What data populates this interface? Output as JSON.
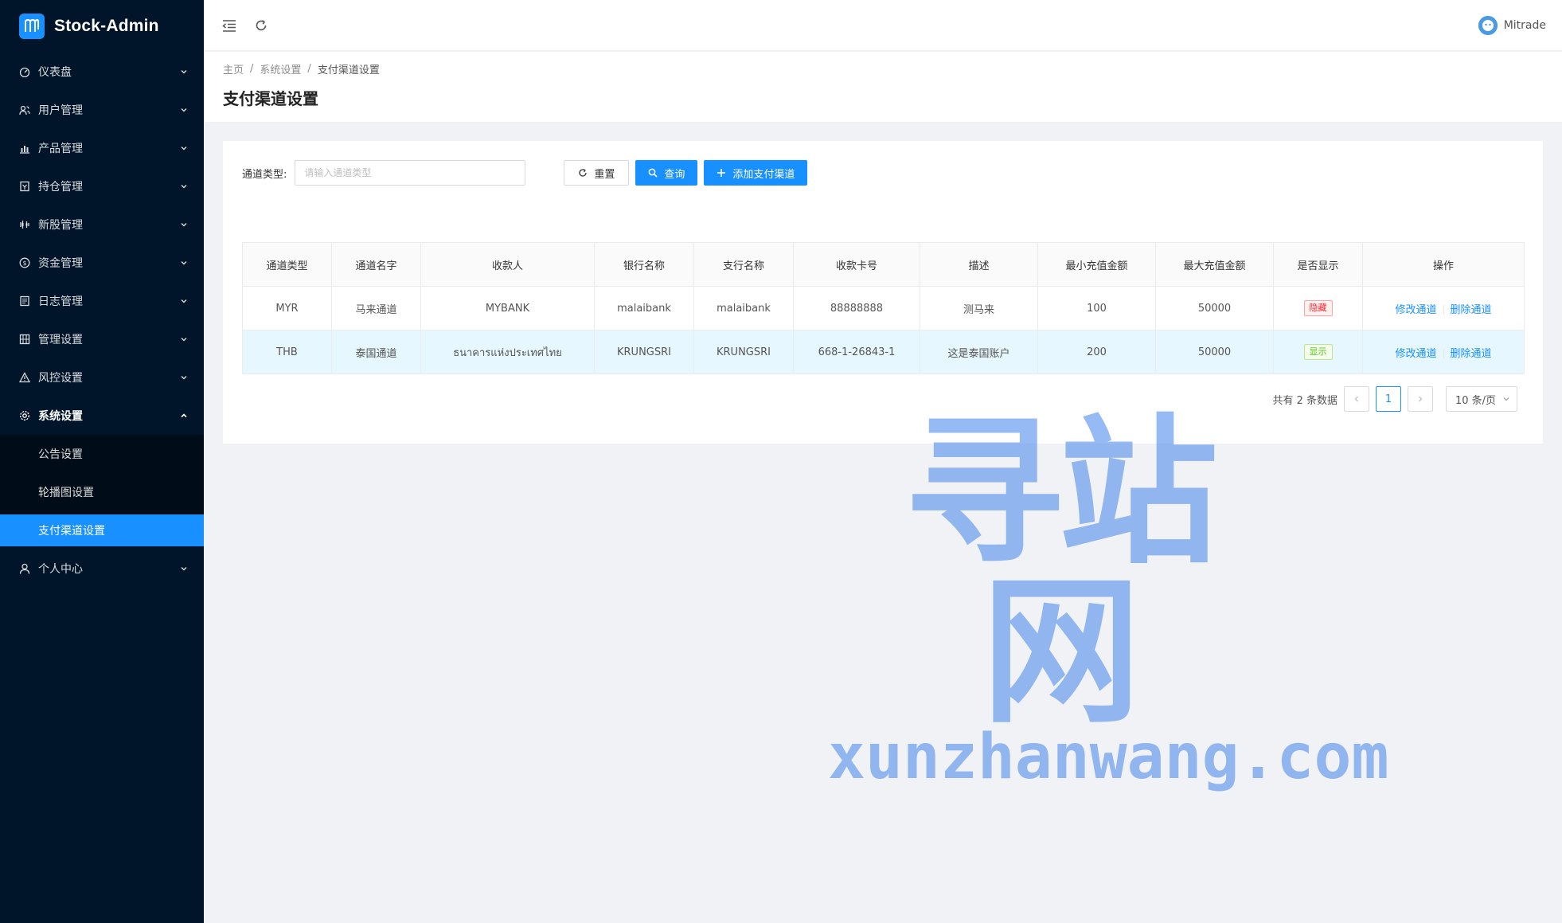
{
  "app": {
    "title": "Stock-Admin"
  },
  "sidebar": {
    "items": [
      {
        "label": "仪表盘",
        "icon": "dashboard-icon"
      },
      {
        "label": "用户管理",
        "icon": "users-icon"
      },
      {
        "label": "产品管理",
        "icon": "chart-icon"
      },
      {
        "label": "持仓管理",
        "icon": "position-icon"
      },
      {
        "label": "新股管理",
        "icon": "ipo-icon"
      },
      {
        "label": "资金管理",
        "icon": "money-icon"
      },
      {
        "label": "日志管理",
        "icon": "log-icon"
      },
      {
        "label": "管理设置",
        "icon": "admin-icon"
      },
      {
        "label": "风控设置",
        "icon": "warning-icon"
      },
      {
        "label": "系统设置",
        "icon": "gear-icon"
      }
    ],
    "submenu": [
      "公告设置",
      "轮播图设置",
      "支付渠道设置"
    ],
    "last_item": {
      "label": "个人中心",
      "icon": "user-icon"
    }
  },
  "header": {
    "username": "Mitrade"
  },
  "breadcrumb": [
    "主页",
    "系统设置",
    "支付渠道设置"
  ],
  "page_title": "支付渠道设置",
  "filter": {
    "label": "通道类型:",
    "placeholder": "请输入通道类型",
    "reset": "重置",
    "search": "查询",
    "add": "添加支付渠道"
  },
  "table": {
    "columns": [
      "通道类型",
      "通道名字",
      "收款人",
      "银行名称",
      "支行名称",
      "收款卡号",
      "描述",
      "最小充值金额",
      "最大充值金额",
      "是否显示",
      "操作"
    ],
    "rows": [
      {
        "type": "MYR",
        "name": "马来通道",
        "payee": "MYBANK",
        "bank": "malaibank",
        "branch": "malaibank",
        "card": "88888888",
        "desc": "测马来",
        "min": "100",
        "max": "50000",
        "visible": "隐藏",
        "edit": "修改通道",
        "del": "删除通道"
      },
      {
        "type": "THB",
        "name": "泰国通道",
        "payee": "ธนาคารแห่งประเทศไทย",
        "bank": "KRUNGSRI",
        "branch": "KRUNGSRI",
        "card": "668-1-26843-1",
        "desc": "这是泰国账户",
        "min": "200",
        "max": "50000",
        "visible": "显示",
        "edit": "修改通道",
        "del": "删除通道"
      }
    ]
  },
  "pagination": {
    "total": "共有 2 条数据",
    "current": "1",
    "page_size": "10 条/页"
  },
  "watermark": {
    "big": "寻站网",
    "small": "xunzhanwang.com"
  }
}
